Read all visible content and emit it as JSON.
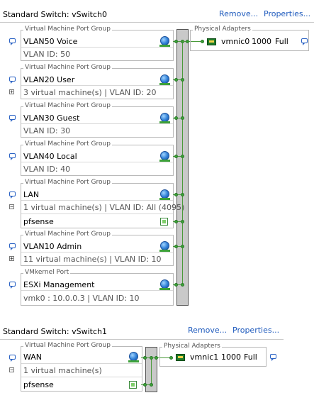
{
  "vswitch0": {
    "title": "Standard Switch: vSwitch0",
    "remove_label": "Remove...",
    "properties_label": "Properties...",
    "port_groups": [
      {
        "type": "Virtual Machine Port Group",
        "name": "VLAN50 Voice",
        "sub": "VLAN ID: 50"
      },
      {
        "type": "Virtual Machine Port Group",
        "name": "VLAN20 User",
        "sub": "3 virtual machine(s) | VLAN ID: 20",
        "expander": "+"
      },
      {
        "type": "Virtual Machine Port Group",
        "name": "VLAN30 Guest",
        "sub": "VLAN ID: 30"
      },
      {
        "type": "Virtual Machine Port Group",
        "name": "VLAN40 Local",
        "sub": "VLAN ID: 40"
      },
      {
        "type": "Virtual Machine Port Group",
        "name": "LAN",
        "sub": "1 virtual machine(s) | VLAN ID: All (4095)",
        "expander": "−",
        "vm": "pfsense"
      },
      {
        "type": "Virtual Machine Port Group",
        "name": "VLAN10 Admin",
        "sub": "11 virtual machine(s) | VLAN ID: 10",
        "expander": "+"
      },
      {
        "type": "VMkernel Port",
        "name": "ESXi Management",
        "sub": "vmk0 : 10.0.0.3 | VLAN ID: 10"
      }
    ],
    "physical_adapters": {
      "label": "Physical Adapters",
      "nic": "vmnic0",
      "speed": "1000",
      "duplex": "Full"
    }
  },
  "vswitch1": {
    "title": "Standard Switch: vSwitch1",
    "remove_label": "Remove...",
    "properties_label": "Properties...",
    "port_groups": [
      {
        "type": "Virtual Machine Port Group",
        "name": "WAN",
        "sub": "1 virtual machine(s)",
        "expander": "−",
        "vm": "pfsense"
      }
    ],
    "physical_adapters": {
      "label": "Physical Adapters",
      "nic": "vmnic1",
      "speed": "1000",
      "duplex": "Full"
    }
  },
  "icons": {
    "port_group": "globe-network-icon",
    "comment": "speech-bubble-icon",
    "vm": "virtual-machine-icon",
    "nic": "network-card-icon"
  },
  "colors": {
    "link": "#1f5bbd",
    "connector": "#3da13a",
    "switch_bar": "#c9c9c9"
  }
}
